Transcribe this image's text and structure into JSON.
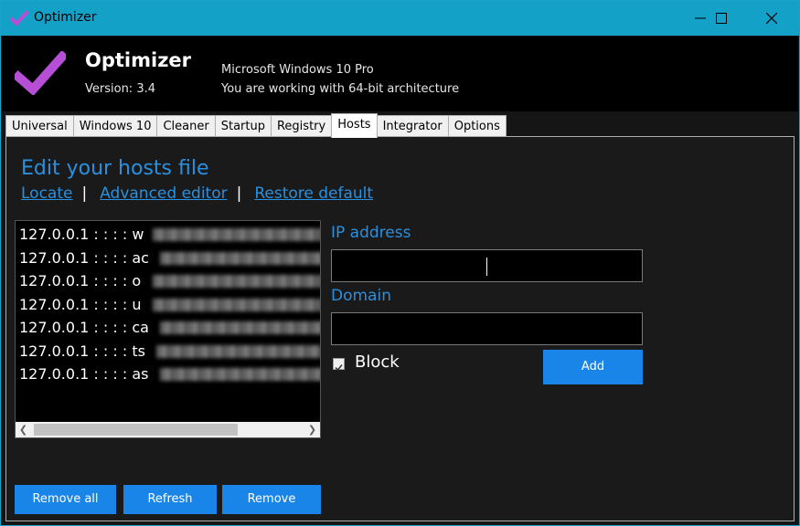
{
  "window": {
    "title": "Optimizer"
  },
  "header": {
    "app_name": "Optimizer",
    "version": "Version: 3.4",
    "os": "Microsoft Windows 10 Pro",
    "arch": "You are working with 64-bit architecture"
  },
  "tabs": [
    {
      "label": "Universal"
    },
    {
      "label": "Windows 10"
    },
    {
      "label": "Cleaner"
    },
    {
      "label": "Startup"
    },
    {
      "label": "Registry"
    },
    {
      "label": "Hosts",
      "active": true
    },
    {
      "label": "Integrator"
    },
    {
      "label": "Options"
    }
  ],
  "hosts": {
    "heading": "Edit your hosts file",
    "links": {
      "locate": "Locate",
      "sep": "|",
      "advanced": "Advanced editor",
      "restore": "Restore default"
    },
    "entries": [
      "127.0.0.1 : : : : w",
      "127.0.0.1 : : : : ac",
      "127.0.0.1 : : : : o",
      "127.0.0.1 : : : : u",
      "127.0.0.1 : : : : ca",
      "127.0.0.1 : : : : ts",
      "127.0.0.1 : : : : as"
    ],
    "ip_label": "IP address",
    "ip_value": "",
    "domain_label": "Domain",
    "domain_value": "",
    "block_label": "Block",
    "block_checked": true,
    "add_button": "Add",
    "remove_all_button": "Remove all",
    "refresh_button": "Refresh",
    "remove_button": "Remove"
  },
  "colors": {
    "accent": "#1a85e8",
    "link": "#2a90e0",
    "titlebar": "#14a1c7",
    "logo": "#b64fd6"
  }
}
